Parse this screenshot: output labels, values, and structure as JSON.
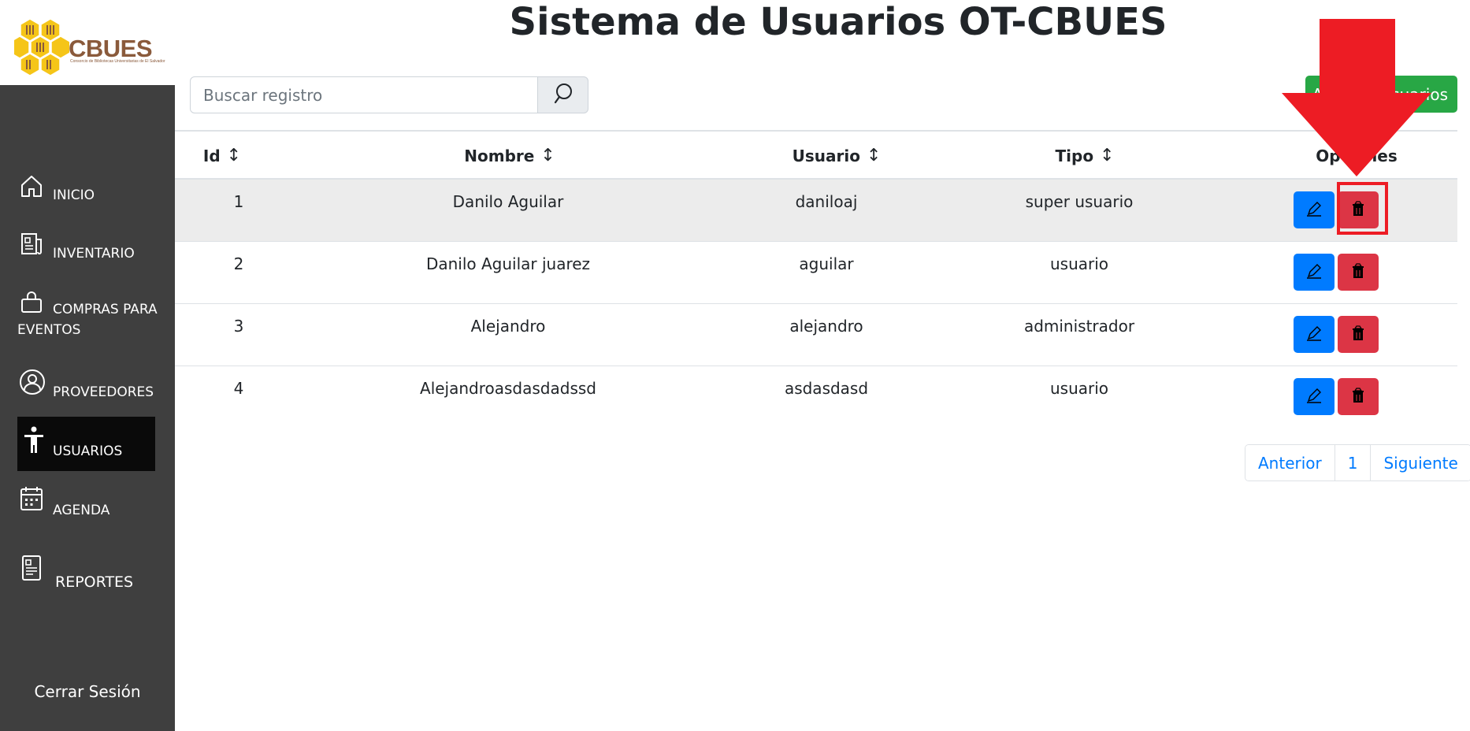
{
  "logo": {
    "name": "CBUES",
    "subtitle": "Consorcio de Bibliotecas Universitarias de El Salvador"
  },
  "page_title": "Sistema de Usuarios OT-CBUES",
  "sidebar": {
    "items": [
      {
        "label": "INICIO",
        "icon": "home-icon",
        "active": false
      },
      {
        "label": "INVENTARIO",
        "icon": "newspaper-icon",
        "active": false
      },
      {
        "label": "COMPRAS PARA EVENTOS",
        "icon": "shopping-bag-icon",
        "active": false
      },
      {
        "label": "PROVEEDORES",
        "icon": "user-circle-icon",
        "active": false
      },
      {
        "label": "USUARIOS",
        "icon": "person-icon",
        "active": true
      },
      {
        "label": "AGENDA",
        "icon": "calendar-icon",
        "active": false
      },
      {
        "label": "REPORTES",
        "icon": "report-icon",
        "active": false
      }
    ],
    "logout_label": "Cerrar Sesión"
  },
  "search": {
    "placeholder": "Buscar registro",
    "icon": "search-icon"
  },
  "add_button_label": "Agregar Usuarios",
  "table": {
    "headers": [
      "Id",
      "Nombre",
      "Usuario",
      "Tipo",
      "Opciones"
    ],
    "rows": [
      {
        "id": "1",
        "nombre": "Danilo Aguilar",
        "usuario": "daniloaj",
        "tipo": "super usuario"
      },
      {
        "id": "2",
        "nombre": "Danilo Aguilar juarez",
        "usuario": "aguilar",
        "tipo": "usuario"
      },
      {
        "id": "3",
        "nombre": "Alejandro",
        "usuario": "alejandro",
        "tipo": "administrador"
      },
      {
        "id": "4",
        "nombre": "Alejandroasdasdadssd",
        "usuario": "asdasdasd",
        "tipo": "usuario"
      }
    ]
  },
  "pagination": {
    "prev": "Anterior",
    "page": "1",
    "next": "Siguiente"
  },
  "colors": {
    "sidebar_bg": "#3f3f3f",
    "active_item_bg": "#0a0a0a",
    "edit_btn": "#007bff",
    "delete_btn": "#dc3545",
    "add_btn": "#28a745",
    "annotation_red": "#ed1c24",
    "logo_yellow": "#f5c518",
    "logo_brown": "#8a5a3b"
  }
}
